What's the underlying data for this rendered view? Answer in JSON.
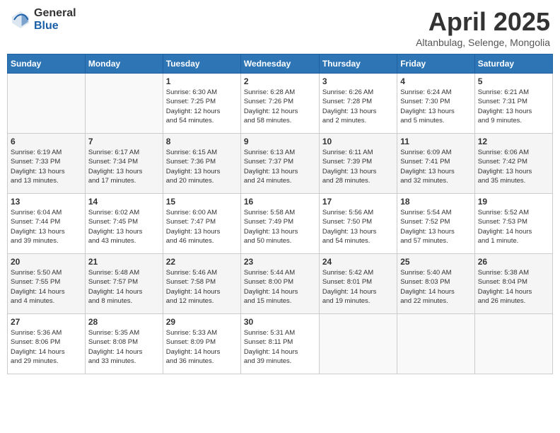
{
  "header": {
    "logo_general": "General",
    "logo_blue": "Blue",
    "month_title": "April 2025",
    "subtitle": "Altanbulag, Selenge, Mongolia"
  },
  "weekdays": [
    "Sunday",
    "Monday",
    "Tuesday",
    "Wednesday",
    "Thursday",
    "Friday",
    "Saturday"
  ],
  "weeks": [
    [
      {
        "day": "",
        "detail": ""
      },
      {
        "day": "",
        "detail": ""
      },
      {
        "day": "1",
        "detail": "Sunrise: 6:30 AM\nSunset: 7:25 PM\nDaylight: 12 hours\nand 54 minutes."
      },
      {
        "day": "2",
        "detail": "Sunrise: 6:28 AM\nSunset: 7:26 PM\nDaylight: 12 hours\nand 58 minutes."
      },
      {
        "day": "3",
        "detail": "Sunrise: 6:26 AM\nSunset: 7:28 PM\nDaylight: 13 hours\nand 2 minutes."
      },
      {
        "day": "4",
        "detail": "Sunrise: 6:24 AM\nSunset: 7:30 PM\nDaylight: 13 hours\nand 5 minutes."
      },
      {
        "day": "5",
        "detail": "Sunrise: 6:21 AM\nSunset: 7:31 PM\nDaylight: 13 hours\nand 9 minutes."
      }
    ],
    [
      {
        "day": "6",
        "detail": "Sunrise: 6:19 AM\nSunset: 7:33 PM\nDaylight: 13 hours\nand 13 minutes."
      },
      {
        "day": "7",
        "detail": "Sunrise: 6:17 AM\nSunset: 7:34 PM\nDaylight: 13 hours\nand 17 minutes."
      },
      {
        "day": "8",
        "detail": "Sunrise: 6:15 AM\nSunset: 7:36 PM\nDaylight: 13 hours\nand 20 minutes."
      },
      {
        "day": "9",
        "detail": "Sunrise: 6:13 AM\nSunset: 7:37 PM\nDaylight: 13 hours\nand 24 minutes."
      },
      {
        "day": "10",
        "detail": "Sunrise: 6:11 AM\nSunset: 7:39 PM\nDaylight: 13 hours\nand 28 minutes."
      },
      {
        "day": "11",
        "detail": "Sunrise: 6:09 AM\nSunset: 7:41 PM\nDaylight: 13 hours\nand 32 minutes."
      },
      {
        "day": "12",
        "detail": "Sunrise: 6:06 AM\nSunset: 7:42 PM\nDaylight: 13 hours\nand 35 minutes."
      }
    ],
    [
      {
        "day": "13",
        "detail": "Sunrise: 6:04 AM\nSunset: 7:44 PM\nDaylight: 13 hours\nand 39 minutes."
      },
      {
        "day": "14",
        "detail": "Sunrise: 6:02 AM\nSunset: 7:45 PM\nDaylight: 13 hours\nand 43 minutes."
      },
      {
        "day": "15",
        "detail": "Sunrise: 6:00 AM\nSunset: 7:47 PM\nDaylight: 13 hours\nand 46 minutes."
      },
      {
        "day": "16",
        "detail": "Sunrise: 5:58 AM\nSunset: 7:49 PM\nDaylight: 13 hours\nand 50 minutes."
      },
      {
        "day": "17",
        "detail": "Sunrise: 5:56 AM\nSunset: 7:50 PM\nDaylight: 13 hours\nand 54 minutes."
      },
      {
        "day": "18",
        "detail": "Sunrise: 5:54 AM\nSunset: 7:52 PM\nDaylight: 13 hours\nand 57 minutes."
      },
      {
        "day": "19",
        "detail": "Sunrise: 5:52 AM\nSunset: 7:53 PM\nDaylight: 14 hours\nand 1 minute."
      }
    ],
    [
      {
        "day": "20",
        "detail": "Sunrise: 5:50 AM\nSunset: 7:55 PM\nDaylight: 14 hours\nand 4 minutes."
      },
      {
        "day": "21",
        "detail": "Sunrise: 5:48 AM\nSunset: 7:57 PM\nDaylight: 14 hours\nand 8 minutes."
      },
      {
        "day": "22",
        "detail": "Sunrise: 5:46 AM\nSunset: 7:58 PM\nDaylight: 14 hours\nand 12 minutes."
      },
      {
        "day": "23",
        "detail": "Sunrise: 5:44 AM\nSunset: 8:00 PM\nDaylight: 14 hours\nand 15 minutes."
      },
      {
        "day": "24",
        "detail": "Sunrise: 5:42 AM\nSunset: 8:01 PM\nDaylight: 14 hours\nand 19 minutes."
      },
      {
        "day": "25",
        "detail": "Sunrise: 5:40 AM\nSunset: 8:03 PM\nDaylight: 14 hours\nand 22 minutes."
      },
      {
        "day": "26",
        "detail": "Sunrise: 5:38 AM\nSunset: 8:04 PM\nDaylight: 14 hours\nand 26 minutes."
      }
    ],
    [
      {
        "day": "27",
        "detail": "Sunrise: 5:36 AM\nSunset: 8:06 PM\nDaylight: 14 hours\nand 29 minutes."
      },
      {
        "day": "28",
        "detail": "Sunrise: 5:35 AM\nSunset: 8:08 PM\nDaylight: 14 hours\nand 33 minutes."
      },
      {
        "day": "29",
        "detail": "Sunrise: 5:33 AM\nSunset: 8:09 PM\nDaylight: 14 hours\nand 36 minutes."
      },
      {
        "day": "30",
        "detail": "Sunrise: 5:31 AM\nSunset: 8:11 PM\nDaylight: 14 hours\nand 39 minutes."
      },
      {
        "day": "",
        "detail": ""
      },
      {
        "day": "",
        "detail": ""
      },
      {
        "day": "",
        "detail": ""
      }
    ]
  ]
}
